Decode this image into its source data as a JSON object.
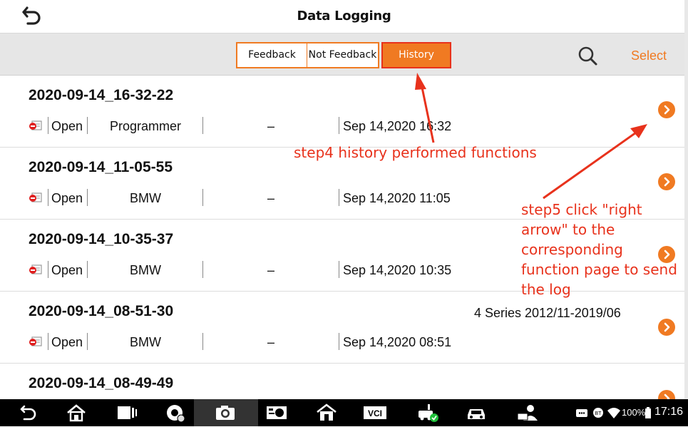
{
  "header": {
    "title": "Data Logging"
  },
  "tabs": [
    {
      "label": "Feedback"
    },
    {
      "label": "Not Feedback"
    },
    {
      "label": "History"
    }
  ],
  "toolbar": {
    "select_label": "Select"
  },
  "rows": [
    {
      "title": "2020-09-14_16-32-22",
      "status": "Open",
      "vehicle": "Programmer",
      "dash": "–",
      "date": "Sep 14,2020 16:32",
      "model": ""
    },
    {
      "title": "2020-09-14_11-05-55",
      "status": "Open",
      "vehicle": "BMW",
      "dash": "–",
      "date": "Sep 14,2020 11:05",
      "model": ""
    },
    {
      "title": "2020-09-14_10-35-37",
      "status": "Open",
      "vehicle": "BMW",
      "dash": "–",
      "date": "Sep 14,2020 10:35",
      "model": ""
    },
    {
      "title": "2020-09-14_08-51-30",
      "status": "Open",
      "vehicle": "BMW",
      "dash": "–",
      "date": "Sep 14,2020 08:51",
      "model": "4 Series  2012/11-2019/06"
    },
    {
      "title": "2020-09-14_08-49-49",
      "status": "",
      "vehicle": "",
      "dash": "",
      "date": "",
      "model": ""
    }
  ],
  "annotations": {
    "step4": "step4 history performed functions",
    "step5": "step5 click \"right arrow\" to the corresponding function page to send the log"
  },
  "statusbar": {
    "battery": "100%",
    "time": "17:16"
  },
  "icons": {
    "back": "back-arrow-icon",
    "search": "search-icon",
    "row_arrow": "chevron-right-icon",
    "row_status": "log-status-icon",
    "nav": [
      "nav-back-icon",
      "home-icon",
      "recent-apps-icon",
      "browser-icon",
      "camera-icon",
      "dashboard-icon",
      "workshop-home-icon",
      "vci-icon",
      "vehicle-connect-icon",
      "car-icon",
      "remote-support-icon"
    ]
  },
  "colors": {
    "accent": "#f07a22",
    "annotation": "#e8321c",
    "toolbar_bg": "#e6e6e6",
    "navbar_bg": "#000000"
  }
}
